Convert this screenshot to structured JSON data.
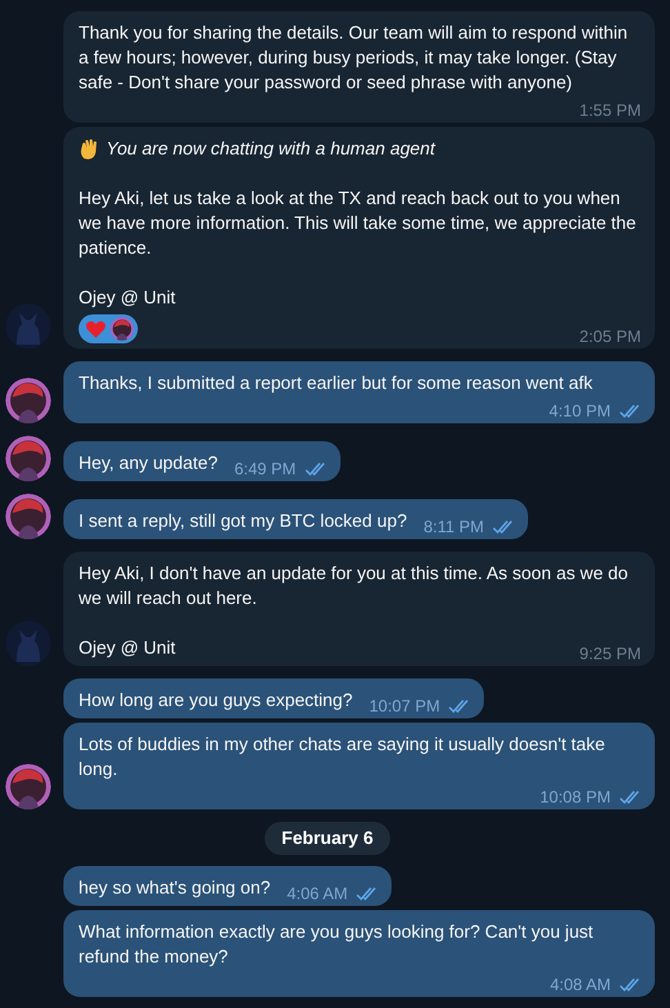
{
  "messages": [
    {
      "kind": "message",
      "outgoing": false,
      "avatar": false,
      "reaction": false,
      "paragraphs": [
        {
          "kind": "text",
          "text": "Thank you for sharing the details. Our team will aim to respond within a few hours; however, during busy periods, it may take longer. (Stay safe - Don't share your password or seed phrase with anyone)"
        }
      ],
      "time": "1:55 PM"
    },
    {
      "kind": "message",
      "outgoing": false,
      "avatar": true,
      "reaction": true,
      "paragraphs": [
        {
          "kind": "notice",
          "text": "You are now chatting with a human agent"
        },
        {
          "kind": "text",
          "text": "Hey Aki, let us take a look at the TX and reach back out to you when we have more information. This will take some time, we appreciate the patience."
        },
        {
          "kind": "text",
          "text": "Ojey @ Unit"
        }
      ],
      "time": "2:05 PM"
    },
    {
      "kind": "message",
      "outgoing": true,
      "avatar": true,
      "read": true,
      "paragraphs": [
        {
          "kind": "text",
          "text": "Thanks, I submitted a report earlier but for some reason went afk"
        }
      ],
      "time": "4:10 PM"
    },
    {
      "kind": "message",
      "outgoing": true,
      "avatar": true,
      "read": true,
      "paragraphs": [
        {
          "kind": "text",
          "text": "Hey, any update?"
        }
      ],
      "time": "6:49 PM"
    },
    {
      "kind": "message",
      "outgoing": true,
      "avatar": true,
      "read": true,
      "paragraphs": [
        {
          "kind": "text",
          "text": "I sent a reply, still got my BTC locked up?"
        }
      ],
      "time": "8:11 PM"
    },
    {
      "kind": "message",
      "outgoing": false,
      "avatar": true,
      "reaction": false,
      "paragraphs": [
        {
          "kind": "text",
          "text": "Hey Aki, I don't have an update for you at this time. As soon as we do we will reach out here."
        },
        {
          "kind": "text",
          "text": "Ojey @ Unit"
        }
      ],
      "time": "9:25 PM"
    },
    {
      "kind": "message",
      "outgoing": true,
      "avatar": false,
      "read": true,
      "paragraphs": [
        {
          "kind": "text",
          "text": "How long are you guys expecting?"
        }
      ],
      "time": "10:07 PM"
    },
    {
      "kind": "message",
      "outgoing": true,
      "avatar": true,
      "read": true,
      "paragraphs": [
        {
          "kind": "text",
          "text": "Lots of buddies in my other chats are saying it usually doesn't take long."
        }
      ],
      "time": "10:08 PM"
    },
    {
      "kind": "date",
      "text": "February 6"
    },
    {
      "kind": "message",
      "outgoing": true,
      "avatar": false,
      "read": true,
      "paragraphs": [
        {
          "kind": "text",
          "text": "hey so what's going on?"
        }
      ],
      "time": "4:06 AM"
    },
    {
      "kind": "message",
      "outgoing": true,
      "avatar": false,
      "read": true,
      "paragraphs": [
        {
          "kind": "text",
          "text": "What information exactly are you guys looking for? Can't you just refund the money?"
        }
      ],
      "time": "4:08 AM"
    }
  ]
}
